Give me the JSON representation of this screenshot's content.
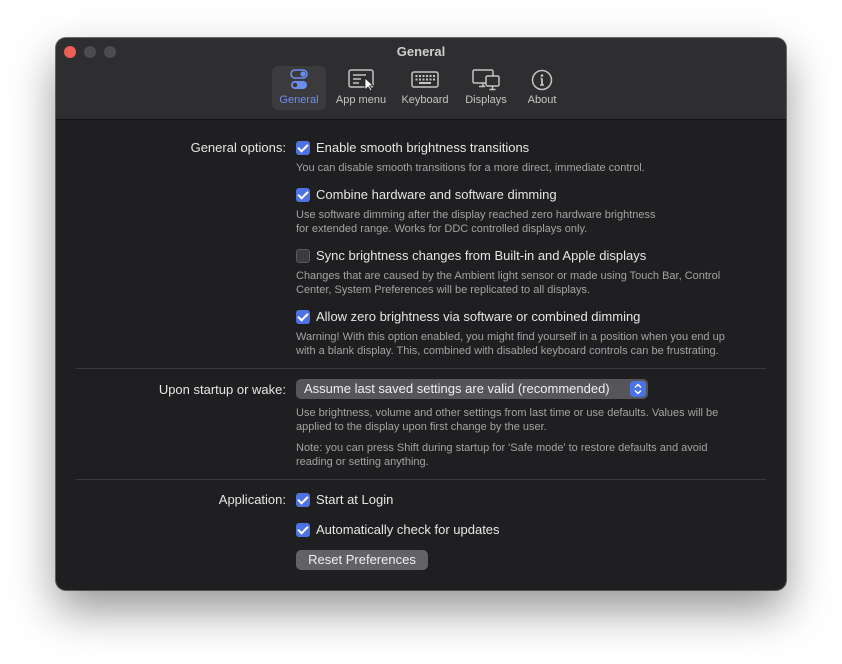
{
  "window": {
    "title": "General"
  },
  "toolbar": {
    "items": [
      {
        "label": "General",
        "icon": "toggle-switches-icon",
        "active": true
      },
      {
        "label": "App menu",
        "icon": "app-menu-icon",
        "active": false
      },
      {
        "label": "Keyboard",
        "icon": "keyboard-icon",
        "active": false
      },
      {
        "label": "Displays",
        "icon": "displays-icon",
        "active": false
      },
      {
        "label": "About",
        "icon": "info-circle-icon",
        "active": false
      }
    ]
  },
  "general_options": {
    "label": "General options:",
    "options": [
      {
        "label": "Enable smooth brightness transitions",
        "checked": true,
        "desc": [
          "You can disable smooth transitions for a more direct, immediate control."
        ]
      },
      {
        "label": "Combine hardware and software dimming",
        "checked": true,
        "desc": [
          "Use software dimming after the display reached zero hardware brightness",
          "for extended range. Works for DDC controlled displays only."
        ]
      },
      {
        "label": "Sync brightness changes from Built-in and Apple displays",
        "checked": false,
        "desc": [
          "Changes that are caused by the Ambient light sensor or made using Touch Bar, Control",
          "Center, System Preferences will be replicated to all displays."
        ]
      },
      {
        "label": "Allow zero brightness via software or combined dimming",
        "checked": true,
        "desc": [
          "Warning! With this option enabled, you might find yourself in a position when you end up",
          "with a blank display. This, combined with disabled keyboard controls can be frustrating."
        ]
      }
    ]
  },
  "startup": {
    "label": "Upon startup or wake:",
    "selected": "Assume last saved settings are valid (recommended)",
    "desc1": [
      "Use brightness, volume and other settings from last time or use defaults. Values will be",
      "applied to the display upon first change by the user."
    ],
    "desc2": [
      "Note: you can press Shift during startup for 'Safe mode' to restore defaults and avoid",
      "reading or setting anything."
    ]
  },
  "application": {
    "label": "Application:",
    "options": [
      {
        "label": "Start at Login",
        "checked": true
      },
      {
        "label": "Automatically check for updates",
        "checked": true
      }
    ],
    "reset_button": "Reset Preferences"
  },
  "colors": {
    "accent": "#4d72e3",
    "active_tab_text": "#6e8cf0",
    "window_bg": "#1f1f21",
    "titlebar_bg": "#2e2e30"
  }
}
